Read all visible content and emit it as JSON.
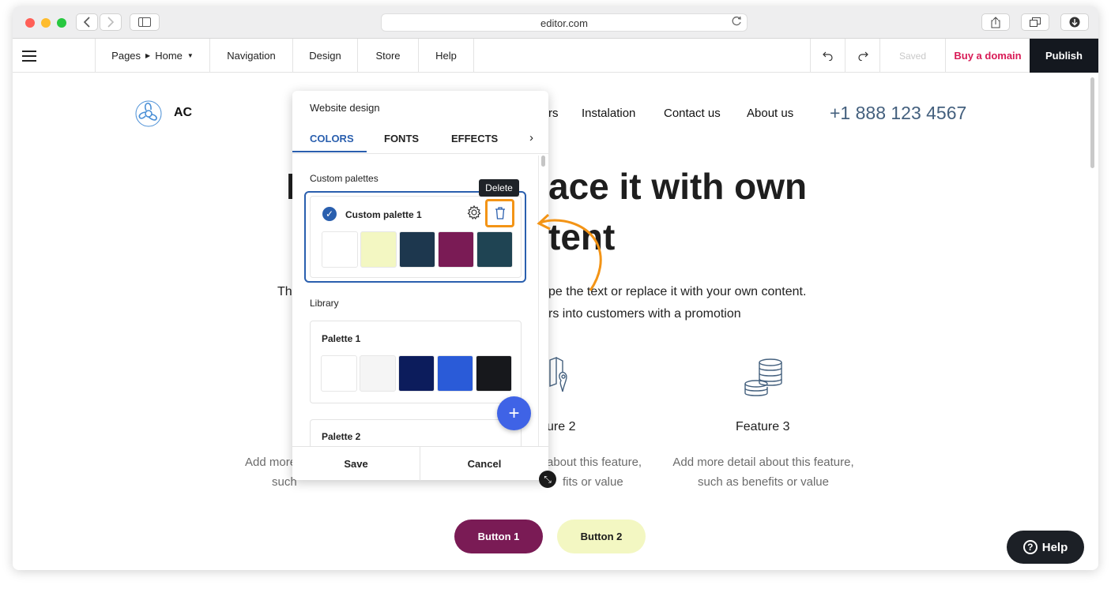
{
  "browser": {
    "url": "editor.com"
  },
  "toolbar": {
    "pages_label": "Pages",
    "page_current": "Home",
    "navigation": "Navigation",
    "design": "Design",
    "store": "Store",
    "help": "Help",
    "saved": "Saved",
    "buy_domain": "Buy a domain",
    "publish": "Publish"
  },
  "site": {
    "logo_text": "AC",
    "nav": [
      "rs",
      "Instalation",
      "Contact us",
      "About us"
    ],
    "phone": "+1 888 123 4567",
    "hero_line1_left": "I",
    "hero_line1": "ace it with own",
    "hero_line2": "tent",
    "sub_line1_left": "Th",
    "sub_line1": "pe the text or replace it with your own content.",
    "sub_line2": "rs into customers with a promotion",
    "features": [
      {
        "title": "ure 2",
        "desc1": "about this feature,",
        "desc2": "fits or value"
      },
      {
        "title": "Feature 3",
        "desc1": "Add more detail about this feature,",
        "desc2": "such as benefits or value"
      }
    ],
    "feat_left_desc1": "Add more",
    "feat_left_desc2": "such",
    "button1": "Button 1",
    "button2": "Button 2",
    "help_button": "Help"
  },
  "design_panel": {
    "title": "Website design",
    "tabs": [
      "COLORS",
      "FONTS",
      "EFFECTS"
    ],
    "active_tab": "COLORS",
    "custom_heading": "Custom palettes",
    "library_heading": "Library",
    "tooltip": "Delete",
    "custom_palettes": [
      {
        "name": "Custom palette 1",
        "colors": [
          "#ffffff",
          "#f3f7c2",
          "#1d374e",
          "#7a1b55",
          "#1f4453"
        ]
      }
    ],
    "library": [
      {
        "name": "Palette 1",
        "colors": [
          "#ffffff",
          "#f5f5f5",
          "#0c1c5c",
          "#2a5bd8",
          "#17181c"
        ]
      },
      {
        "name": "Palette 2",
        "colors": []
      }
    ],
    "save": "Save",
    "cancel": "Cancel"
  },
  "colors": {
    "accent": "#2a5fae",
    "highlight": "#f39416",
    "publish_bg": "#14181f",
    "buy_domain": "#d81b56",
    "fab": "#3f63e6"
  },
  "icons": [
    "hamburger-icon",
    "back-icon",
    "forward-icon",
    "sidebar-icon",
    "reload-icon",
    "share-icon",
    "tabs-icon",
    "download-icon",
    "undo-icon",
    "redo-icon",
    "logo-icon",
    "gear-icon",
    "trash-icon",
    "check-icon",
    "plus-icon",
    "resize-icon",
    "map-pin-icon",
    "coins-icon",
    "help-icon"
  ]
}
